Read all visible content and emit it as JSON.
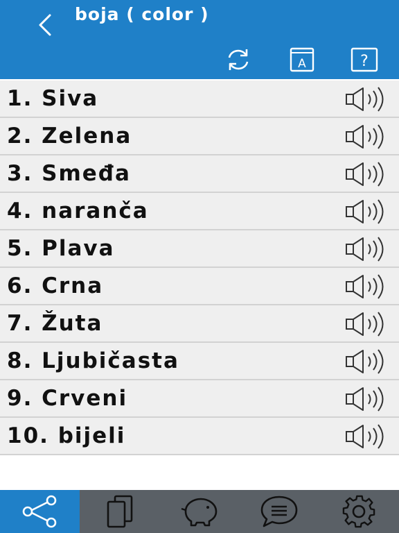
{
  "header": {
    "title": "boja ( color )",
    "back_icon": "chevron-left-icon",
    "tools": [
      {
        "name": "refresh-icon"
      },
      {
        "name": "dictionary-icon",
        "letter": "A"
      },
      {
        "name": "help-icon",
        "symbol": "?"
      }
    ]
  },
  "list": {
    "items": [
      {
        "label": "1. Siva"
      },
      {
        "label": "2. Zelena"
      },
      {
        "label": "3. Smeđa"
      },
      {
        "label": "4. naranča"
      },
      {
        "label": "5. Plava"
      },
      {
        "label": "6. Crna"
      },
      {
        "label": "7. Žuta"
      },
      {
        "label": "8. Ljubičasta"
      },
      {
        "label": "9. Crveni"
      },
      {
        "label": "10. bijeli"
      }
    ],
    "item_icon": "speaker-icon"
  },
  "tabbar": {
    "tabs": [
      {
        "icon": "share-icon",
        "active": true
      },
      {
        "icon": "copy-icon",
        "active": false
      },
      {
        "icon": "piggy-bank-icon",
        "active": false
      },
      {
        "icon": "chat-icon",
        "active": false
      },
      {
        "icon": "gear-icon",
        "active": false
      }
    ]
  },
  "colors": {
    "accent": "#1f80c8",
    "row_bg": "#efefef",
    "tabbar_bg": "#5a6066",
    "text": "#111111"
  }
}
